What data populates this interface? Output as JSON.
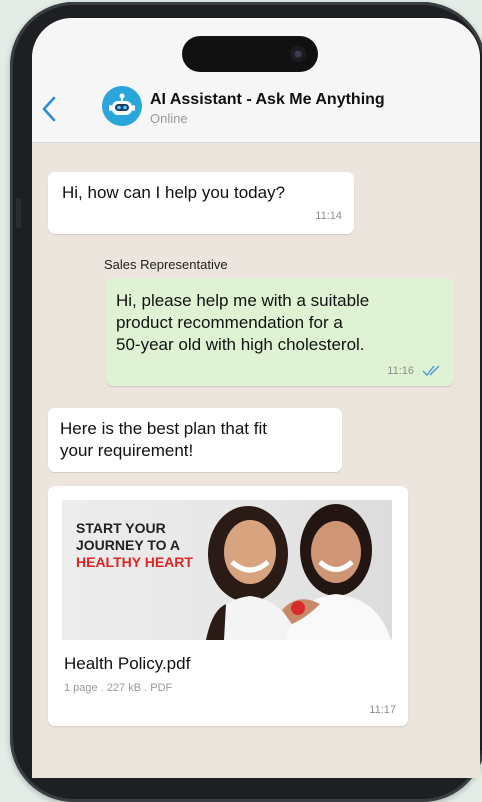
{
  "header": {
    "title": "AI Assistant - Ask Me Anything",
    "status": "Online"
  },
  "messages": [
    {
      "type": "incoming",
      "text": "Hi, how can I help you today?",
      "time": "11:14"
    },
    {
      "type": "outgoing",
      "sender": "Sales Representative",
      "lines": [
        "Hi, please help me with a suitable",
        "product recommendation for a",
        "50-year old with high cholesterol."
      ],
      "time": "11:16"
    },
    {
      "type": "incoming",
      "lines": [
        "Here is the best plan that fit",
        "your requirement!"
      ]
    },
    {
      "type": "attachment",
      "promo": {
        "line1": "START YOUR",
        "line2": "JOURNEY TO A",
        "line3": "HEALTHY HEART"
      },
      "file_name": "Health Policy.pdf",
      "file_meta": "1 page . 227 kB . PDF",
      "time": "11:17"
    }
  ],
  "colors": {
    "sent_bubble": "#e0f2d4",
    "received_bubble": "#ffffff",
    "chat_background": "#ece5dd",
    "accent_blue": "#2aa6da",
    "promo_accent": "#e02424"
  }
}
